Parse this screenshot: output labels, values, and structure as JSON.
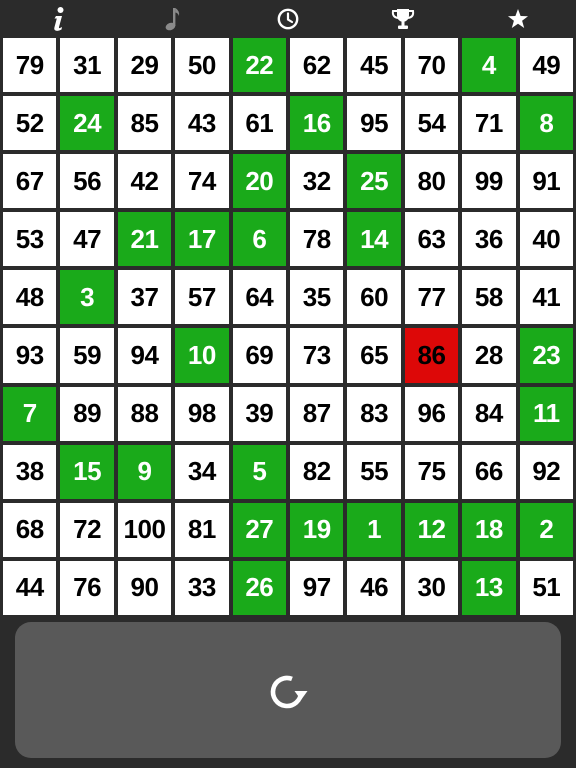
{
  "toolbar": {
    "icons": [
      "info-icon",
      "music-note-icon",
      "clock-icon",
      "trophy-icon",
      "star-icon"
    ],
    "icon_color": "#ffffff",
    "music_icon_color": "#8a8a8a"
  },
  "board": {
    "rows": [
      [
        79,
        31,
        29,
        50,
        22,
        62,
        45,
        70,
        4,
        49
      ],
      [
        52,
        24,
        85,
        43,
        61,
        16,
        95,
        54,
        71,
        8
      ],
      [
        67,
        56,
        42,
        74,
        20,
        32,
        25,
        80,
        99,
        91
      ],
      [
        53,
        47,
        21,
        17,
        6,
        78,
        14,
        63,
        36,
        40
      ],
      [
        48,
        3,
        37,
        57,
        64,
        35,
        60,
        77,
        58,
        41
      ],
      [
        93,
        59,
        94,
        10,
        69,
        73,
        65,
        86,
        28,
        23
      ],
      [
        7,
        89,
        88,
        98,
        39,
        87,
        83,
        96,
        84,
        11
      ],
      [
        38,
        15,
        9,
        34,
        5,
        82,
        55,
        75,
        66,
        92
      ],
      [
        68,
        72,
        100,
        81,
        27,
        19,
        1,
        12,
        18,
        2
      ],
      [
        44,
        76,
        90,
        33,
        26,
        97,
        46,
        30,
        13,
        51
      ]
    ],
    "found_numbers": [
      1,
      2,
      3,
      4,
      5,
      6,
      7,
      8,
      9,
      10,
      11,
      12,
      13,
      14,
      15,
      16,
      17,
      18,
      19,
      20,
      21,
      22,
      23,
      24,
      25,
      26,
      27
    ],
    "wrong_number": 86,
    "colors": {
      "cell": "#ffffff",
      "found": "#1aaa1a",
      "wrong": "#dd0808",
      "background": "#2b2b2b",
      "panel": "#595959"
    }
  },
  "controls": {
    "reset_icon": "refresh-icon"
  }
}
